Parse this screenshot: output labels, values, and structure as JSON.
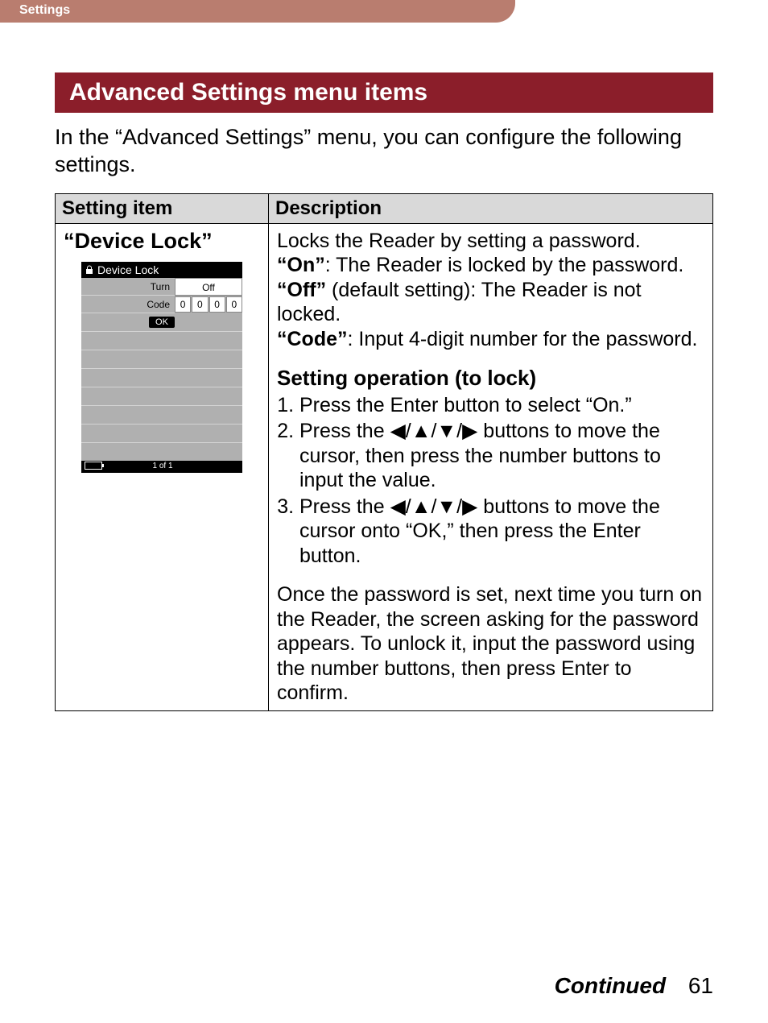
{
  "header": {
    "tab": "Settings"
  },
  "section_title": "Advanced Settings menu items",
  "intro": "In the “Advanced Settings” menu, you can configure the following settings.",
  "table": {
    "col1": "Setting item",
    "col2": "Description",
    "setting_name": "“Device Lock”"
  },
  "mock": {
    "title": "Device Lock",
    "turn_label": "Turn",
    "turn_value": "Off",
    "code_label": "Code",
    "code_digits": [
      "0",
      "0",
      "0",
      "0"
    ],
    "ok": "OK",
    "page": "1 of 1"
  },
  "desc": {
    "line1": "Locks the Reader by setting a password.",
    "on_label": "“On”",
    "on_text": ": The Reader is locked by the password.",
    "off_label": "“Off”",
    "off_text": " (default setting): The Reader is not locked.",
    "code_label": "“Code”",
    "code_text": ": Input 4-digit number for the password.",
    "op_title": "Setting operation (to lock)",
    "step1": "Press the Enter button to select “On.”",
    "step2a": "Press the ",
    "step2b": " buttons to move the cursor, then press the number buttons to input the value.",
    "step3a": "Press the ",
    "step3b": " buttons to move the cursor onto “OK,” then press the Enter button.",
    "arrows": "◀/▲/▼/▶",
    "after": "Once the password is set, next time you turn on the Reader, the screen asking for the password appears. To unlock it, input the password using the number buttons, then press Enter to confirm."
  },
  "footer": {
    "continued": "Continued",
    "page_num": "61"
  }
}
